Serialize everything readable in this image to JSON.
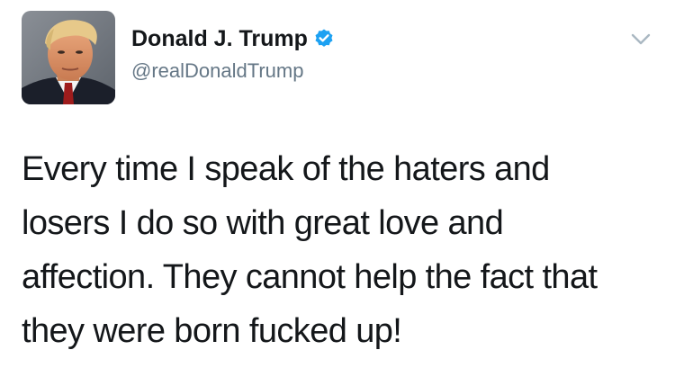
{
  "tweet": {
    "author": {
      "display_name": "Donald J. Trump",
      "handle": "@realDonaldTrump",
      "verified": true,
      "avatar_icon": "profile-photo"
    },
    "menu_icon": "chevron-down-icon",
    "text_lines": [
      "Every time I speak of the haters and",
      "losers I do so with great love and",
      "affection. They cannot help the fact that",
      "they were born fucked up!"
    ]
  },
  "colors": {
    "verified_badge": "#1da1f2",
    "handle": "#657786",
    "text": "#14171a",
    "chevron": "#aab8c2"
  }
}
